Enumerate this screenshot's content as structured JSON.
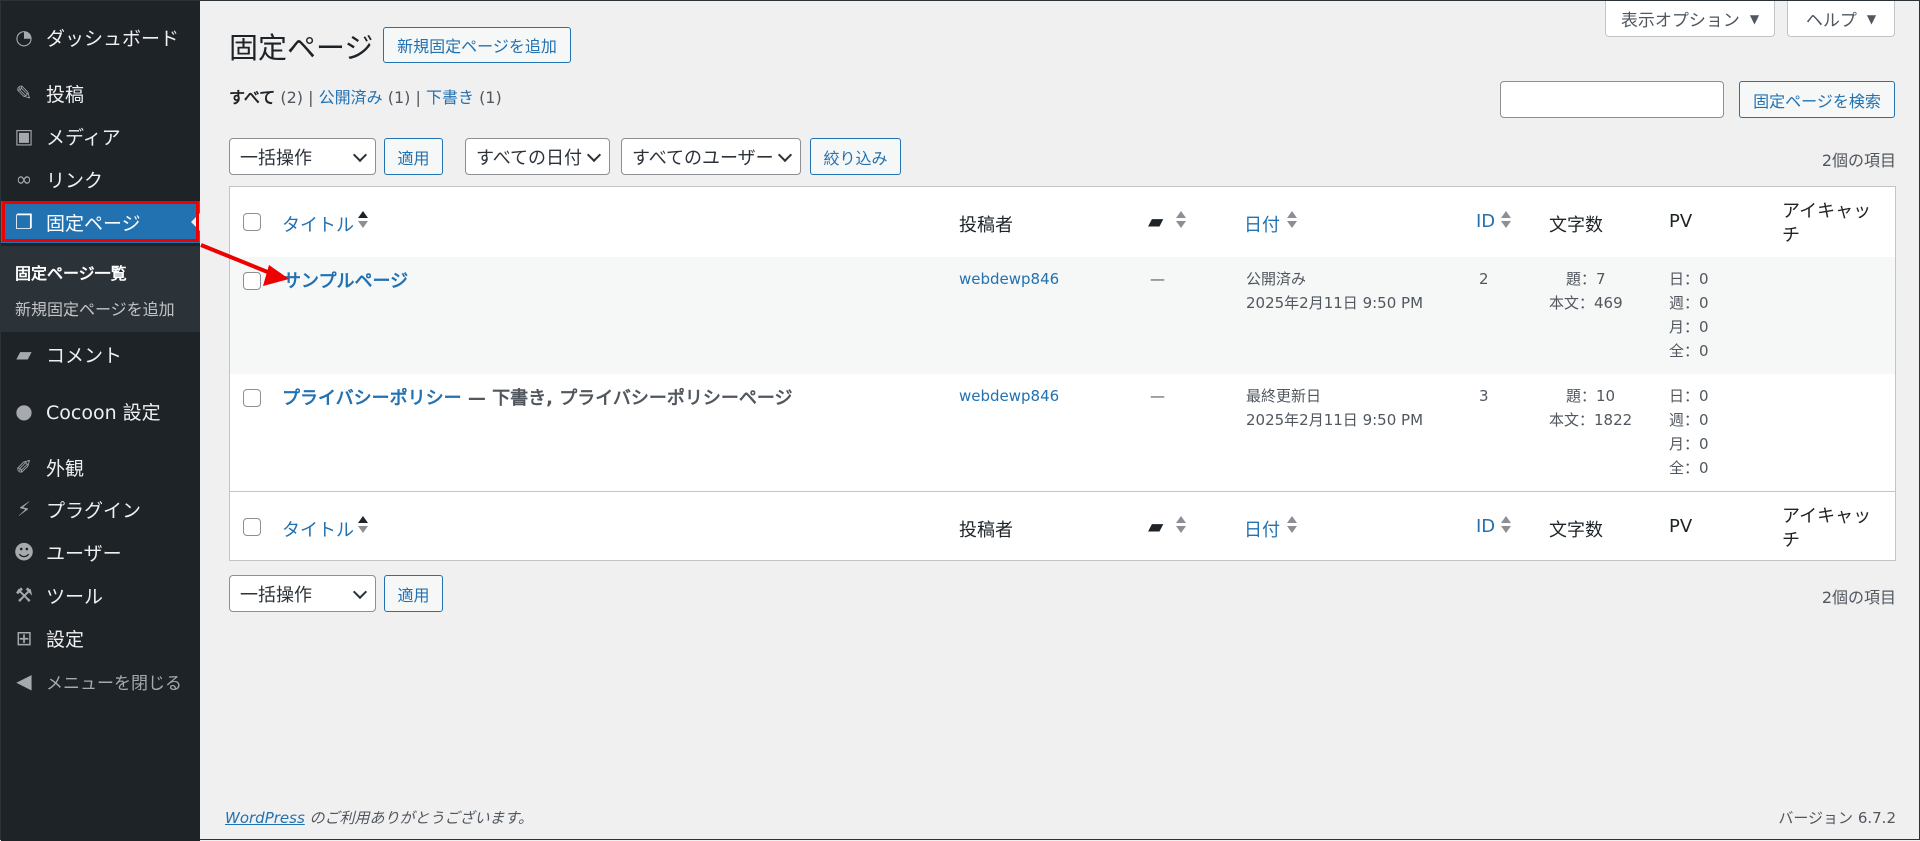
{
  "sidebar": {
    "items": [
      {
        "label": "ダッシュボード",
        "icon": "dashboard-icon"
      },
      {
        "label": "投稿",
        "icon": "pin-icon"
      },
      {
        "label": "メディア",
        "icon": "media-icon"
      },
      {
        "label": "リンク",
        "icon": "link-icon"
      },
      {
        "label": "固定ページ",
        "icon": "pages-icon"
      },
      {
        "label": "コメント",
        "icon": "comment-icon"
      },
      {
        "label": "Cocoon 設定",
        "icon": "circle-icon"
      },
      {
        "label": "外観",
        "icon": "brush-icon"
      },
      {
        "label": "プラグイン",
        "icon": "plugin-icon"
      },
      {
        "label": "ユーザー",
        "icon": "user-icon"
      },
      {
        "label": "ツール",
        "icon": "wrench-icon"
      },
      {
        "label": "設定",
        "icon": "settings-icon"
      },
      {
        "label": "メニューを閉じる",
        "icon": "collapse-icon"
      }
    ],
    "submenu": [
      "固定ページ一覧",
      "新規固定ページを追加"
    ]
  },
  "screen_tabs": {
    "options": "表示オプション",
    "help": "ヘルプ"
  },
  "header": {
    "title": "固定ページ",
    "add_new": "新規固定ページを追加"
  },
  "subsubsub": {
    "all": "すべて",
    "all_count": "(2)",
    "publish": "公開済み",
    "publish_count": "(1)",
    "draft": "下書き",
    "draft_count": "(1)"
  },
  "search": {
    "value": "",
    "button": "固定ページを検索"
  },
  "tablenav": {
    "bulk": "一括操作",
    "apply": "適用",
    "dates": "すべての日付",
    "users": "すべてのユーザー",
    "filter": "絞り込み",
    "count": "2個の項目"
  },
  "table": {
    "columns": {
      "title": "タイトル",
      "author": "投稿者",
      "date": "日付",
      "id": "ID",
      "chars": "文字数",
      "pv": "PV",
      "thumb_1": "アイキャッ",
      "thumb_2": "チ"
    },
    "rows": [
      {
        "title": "サンプルページ",
        "state": "",
        "author": "webdewp846",
        "comments": "—",
        "date_status": "公開済み",
        "date": "2025年2月11日 9:50 PM",
        "id": "2",
        "chars_title": "題：7",
        "chars_body": "本文：469",
        "pv_day": "日：0",
        "pv_week": "週：0",
        "pv_month": "月：0",
        "pv_all": "全：0"
      },
      {
        "title": "プライバシーポリシー",
        "state": " — 下書き, プライバシーポリシーページ",
        "author": "webdewp846",
        "comments": "—",
        "date_status": "最終更新日",
        "date": "2025年2月11日 9:50 PM",
        "id": "3",
        "chars_title": "題：10",
        "chars_body": "本文：1822",
        "pv_day": "日：0",
        "pv_week": "週：0",
        "pv_month": "月：0",
        "pv_all": "全：0"
      }
    ]
  },
  "footer": {
    "wp": "WordPress",
    "thanks": " のご利用ありがとうございます。",
    "version": "バージョン 6.7.2"
  },
  "colors": {
    "sidebar": "#1d2327",
    "accent": "#2271b1",
    "annotation": "#ee0000"
  }
}
